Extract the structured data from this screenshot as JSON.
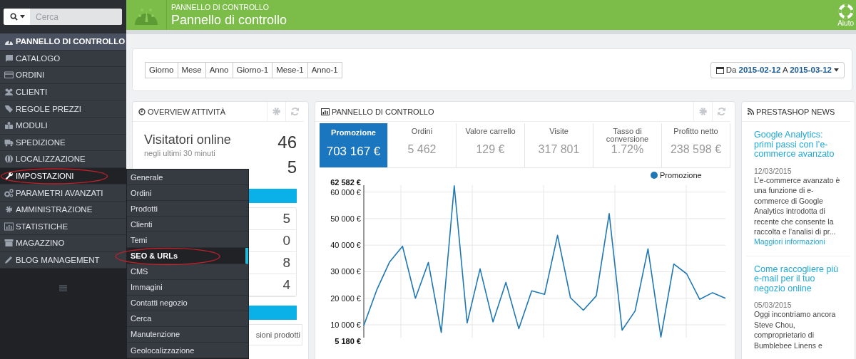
{
  "sidebar": {
    "search": {
      "placeholder": "Cerca"
    },
    "items": [
      {
        "label": "PANNELLO DI CONTROLLO",
        "selected": true,
        "expanded": false,
        "circled": false
      },
      {
        "label": "CATALOGO",
        "selected": false,
        "expanded": false,
        "circled": false
      },
      {
        "label": "ORDINI",
        "selected": false,
        "expanded": false,
        "circled": false
      },
      {
        "label": "CLIENTI",
        "selected": false,
        "expanded": false,
        "circled": false
      },
      {
        "label": "REGOLE PREZZI",
        "selected": false,
        "expanded": false,
        "circled": false
      },
      {
        "label": "MODULI",
        "selected": false,
        "expanded": false,
        "circled": false
      },
      {
        "label": "SPEDIZIONE",
        "selected": false,
        "expanded": false,
        "circled": false
      },
      {
        "label": "LOCALIZZAZIONE",
        "selected": false,
        "expanded": false,
        "circled": false
      },
      {
        "label": "IMPOSTAZIONI",
        "selected": false,
        "expanded": true,
        "circled": true
      },
      {
        "label": "PARAMETRI AVANZATI",
        "selected": false,
        "expanded": false,
        "circled": false
      },
      {
        "label": "AMMINISTRAZIONE",
        "selected": false,
        "expanded": false,
        "circled": false
      },
      {
        "label": "STATISTICHE",
        "selected": false,
        "expanded": false,
        "circled": false
      },
      {
        "label": "MAGAZZINO",
        "selected": false,
        "expanded": false,
        "circled": false
      },
      {
        "label": "BLOG MANAGEMENT",
        "selected": false,
        "expanded": false,
        "circled": false
      }
    ],
    "submenu": [
      {
        "label": "Generale",
        "selected": false,
        "circled": false
      },
      {
        "label": "Ordini",
        "selected": false,
        "circled": false
      },
      {
        "label": "Prodotti",
        "selected": false,
        "circled": false
      },
      {
        "label": "Clienti",
        "selected": false,
        "circled": false
      },
      {
        "label": "Temi",
        "selected": false,
        "circled": false
      },
      {
        "label": "SEO & URLs",
        "selected": true,
        "circled": true
      },
      {
        "label": "CMS",
        "selected": false,
        "circled": false
      },
      {
        "label": "Immagini",
        "selected": false,
        "circled": false
      },
      {
        "label": "Contatti negozio",
        "selected": false,
        "circled": false
      },
      {
        "label": "Cerca",
        "selected": false,
        "circled": false
      },
      {
        "label": "Manutenzione",
        "selected": false,
        "circled": false
      },
      {
        "label": "Geolocalizzazione",
        "selected": false,
        "circled": false
      }
    ]
  },
  "header": {
    "breadcrumb": "PANNELLO DI CONTROLLO",
    "title": "Pannello di controllo",
    "help": "Aiuto"
  },
  "period_buttons": [
    "Giorno",
    "Mese",
    "Anno",
    "Giorno-1",
    "Mese-1",
    "Anno-1"
  ],
  "date_range": {
    "from_label": "Da",
    "from": "2015-02-12",
    "to_label": "A",
    "to": "2015-03-12"
  },
  "overview": {
    "title": "OVERVIEW ATTIVITÀ",
    "visitors_label": "Visitatori online",
    "visitors_note": "negli ultimi 30 minuti",
    "visitors_value": "46",
    "carts_value": "5",
    "list_values": [
      "5",
      "0",
      "8",
      "4"
    ],
    "footer_text": "sioni prodotti"
  },
  "dashboard": {
    "title": "PANNELLO DI CONTROLLO",
    "kpis": [
      {
        "label": "Promozione",
        "value": "703 167 €",
        "selected": true
      },
      {
        "label": "Ordini",
        "value": "5 462",
        "selected": false
      },
      {
        "label": "Valore carrello",
        "value": "129 €",
        "selected": false
      },
      {
        "label": "Visite",
        "value": "317 801",
        "selected": false
      },
      {
        "label": "Tasso di conversione",
        "value": "1.72%",
        "selected": false
      },
      {
        "label": "Profitto netto",
        "value": "238 598 €",
        "selected": false
      }
    ],
    "chart_data": {
      "type": "line",
      "grid": true,
      "ylim": [
        5180,
        62582
      ],
      "yticks": [
        {
          "value": 5180,
          "label": "5 180 €"
        },
        {
          "value": 10000,
          "label": "10 000 €"
        },
        {
          "value": 20000,
          "label": "20 000 €"
        },
        {
          "value": 30000,
          "label": "30 000 €"
        },
        {
          "value": 40000,
          "label": "40 000 €"
        },
        {
          "value": 50000,
          "label": "50 000 €"
        },
        {
          "value": 60000,
          "label": "60 000 €"
        },
        {
          "value": 62582,
          "label": "62 582 €"
        }
      ],
      "series": [
        {
          "name": "Promozione",
          "color": "#1f77b4",
          "values": [
            9700,
            23100,
            33700,
            39600,
            20000,
            33500,
            7100,
            62400,
            10700,
            31100,
            11100,
            26000,
            8500,
            22800,
            21500,
            43700,
            20200,
            15500,
            20900,
            51900,
            8000,
            15200,
            38600,
            5400,
            32900,
            29200,
            19600,
            22100,
            20000
          ]
        }
      ]
    }
  },
  "news": {
    "title": "PRESTASHOP NEWS",
    "articles": [
      {
        "title": "Google Analytics: primi passi con l’e-commerce avanzato",
        "date": "12/03/2015",
        "text": "L’e-commerce avanzato è una funzione di e-commerce di Google Analytics introdotta di recente che consente la raccolta e l’analisi di pr...",
        "link": "Maggiori informazioni"
      },
      {
        "title": "Come raccogliere più e-mail per il tuo negozio online",
        "date": "05/03/2015",
        "text": "Oggi incontriamo ancora Steve Chou, comproprietario di Bumblebee Linens e"
      }
    ]
  }
}
